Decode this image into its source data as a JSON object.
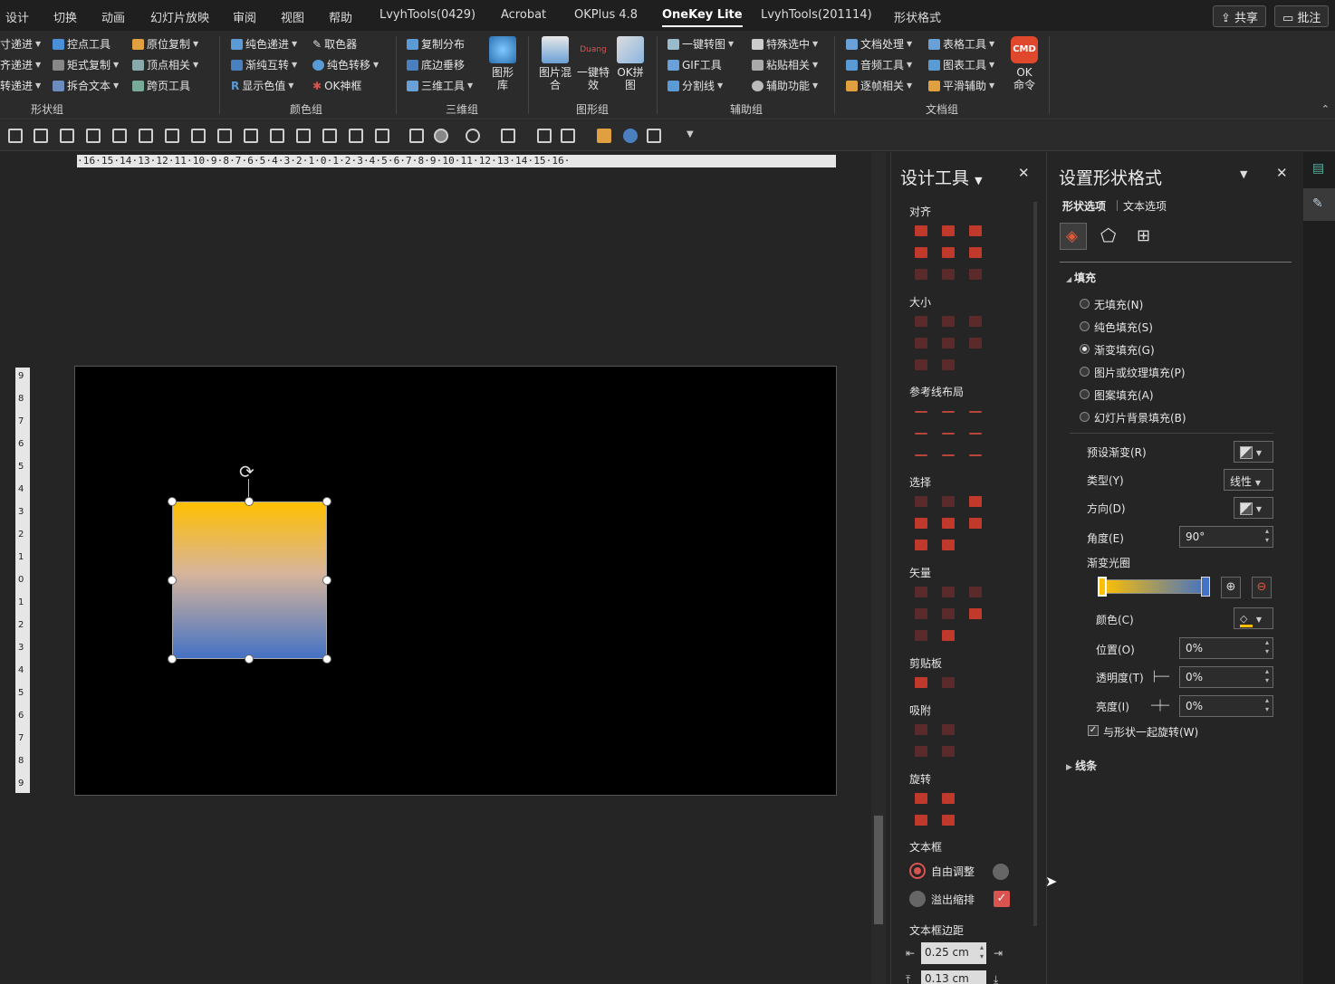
{
  "menubar": {
    "tabs": [
      "设计",
      "切换",
      "动画",
      "幻灯片放映",
      "审阅",
      "视图",
      "帮助",
      "LvyhTools(0429)",
      "Acrobat",
      "OKPlus 4.8",
      "OneKey Lite",
      "LvyhTools(201114)",
      "形状格式"
    ],
    "active_tab": "OneKey Lite",
    "share_label": "共享",
    "comment_label": "批注"
  },
  "ribbon": {
    "shape_group": {
      "col1": [
        "寸递进",
        "齐递进",
        "转递进"
      ],
      "col2": [
        "控点工具",
        "矩式复制",
        "拆合文本"
      ],
      "col3": [
        "原位复制",
        "顶点相关",
        "跨页工具"
      ],
      "label": "形状组"
    },
    "color_group": {
      "col1": [
        "纯色递进",
        "渐纯互转",
        "显示色值"
      ],
      "col2": [
        "取色器",
        "纯色转移",
        "OK神框"
      ],
      "label": "颜色组"
    },
    "three_d_group": {
      "col1": [
        "复制分布",
        "底边垂移",
        "三维工具"
      ],
      "big": "图形库",
      "label": "三维组"
    },
    "graphic_group": {
      "big1": "图片混合",
      "big2": "一键特效",
      "big2_tag": "Duang",
      "big3": "OK拼图",
      "label": "图形组"
    },
    "assist_group": {
      "col1": [
        "一键转图",
        "GIF工具",
        "分割线"
      ],
      "col2": [
        "特殊选中",
        "粘贴相关",
        "辅助功能"
      ],
      "label": "辅助组"
    },
    "doc_group": {
      "col1": [
        "文档处理",
        "音频工具",
        "逐帧相关"
      ],
      "col2": [
        "表格工具",
        "图表工具",
        "平滑辅助"
      ],
      "big": "OK命令",
      "big_tag": "CMD",
      "label": "文档组"
    }
  },
  "ruler": {
    "horizontal": "·16·15·14·13·12·11·10·9·8·7·6·5·4·3·2·1·0·1·2·3·4·5·6·7·8·9·10·11·12·13·14·15·16·",
    "vertical": [
      "9",
      "8",
      "7",
      "6",
      "5",
      "4",
      "3",
      "2",
      "1",
      "0",
      "1",
      "2",
      "3",
      "4",
      "5",
      "6",
      "7",
      "8",
      "9"
    ]
  },
  "shape": {
    "gradient_top": "#ffc000",
    "gradient_bottom": "#4472c4"
  },
  "design_pane": {
    "title": "设计工具",
    "sections": [
      "对齐",
      "大小",
      "参考线布局",
      "选择",
      "矢量",
      "剪贴板",
      "吸附",
      "旋转",
      "文本框",
      "文本框边距"
    ],
    "textbox_options": {
      "auto_fit": "自由调整",
      "overflow": "溢出缩排"
    },
    "margin_left": "0.25 cm",
    "margin_top": "0.13 cm"
  },
  "format_pane": {
    "title": "设置形状格式",
    "tab_shape": "形状选项",
    "tab_text": "文本选项",
    "fill_section": "填充",
    "fill_options": [
      {
        "label": "无填充(N)",
        "selected": false
      },
      {
        "label": "纯色填充(S)",
        "selected": false
      },
      {
        "label": "渐变填充(G)",
        "selected": true
      },
      {
        "label": "图片或纹理填充(P)",
        "selected": false
      },
      {
        "label": "图案填充(A)",
        "selected": false
      },
      {
        "label": "幻灯片背景填充(B)",
        "selected": false
      }
    ],
    "preset_label": "预设渐变(R)",
    "type_label": "类型(Y)",
    "type_value": "线性",
    "direction_label": "方向(D)",
    "angle_label": "角度(E)",
    "angle_value": "90°",
    "stops_label": "渐变光圈",
    "color_label": "颜色(C)",
    "position_label": "位置(O)",
    "position_value": "0%",
    "transparency_label": "透明度(T)",
    "transparency_value": "0%",
    "brightness_label": "亮度(I)",
    "brightness_value": "0%",
    "rotate_with_shape": "与形状一起旋转(W)",
    "line_section": "线条",
    "accent": "#c0392b"
  }
}
